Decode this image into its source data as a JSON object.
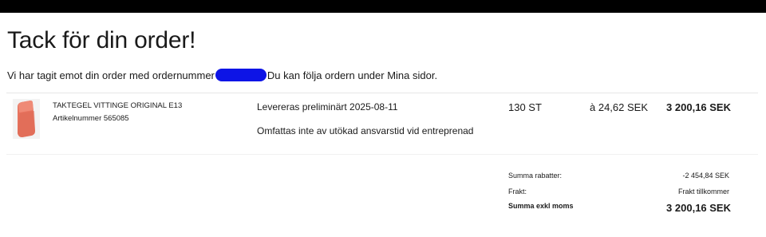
{
  "page": {
    "title": "Tack för din order!",
    "intro_before": "Vi har tagit emot din order med ordernummer",
    "intro_after": "Du kan följa ordern under Mina sidor."
  },
  "order_line": {
    "product_name": "TAKTEGEL VITTINGE ORIGINAL E13",
    "article_number": "Artikelnummer 565085",
    "delivery": "Levereras preliminärt 2025-08-11",
    "note": "Omfattas inte av utökad ansvarstid vid entreprenad",
    "quantity": "130 ST",
    "unit_price": "à 24,62 SEK",
    "line_total": "3 200,16 SEK"
  },
  "summary": {
    "discount_label": "Summa rabatter:",
    "discount_value": "-2 454,84 SEK",
    "shipping_label": "Frakt:",
    "shipping_value": "Frakt tillkommer",
    "total_label": "Summa exkl moms",
    "total_value": "3 200,16 SEK"
  },
  "colors": {
    "redaction": "#0d14e6",
    "product_tile": "#e8735e"
  },
  "icons": {
    "product_image": "roof-tile-image"
  }
}
